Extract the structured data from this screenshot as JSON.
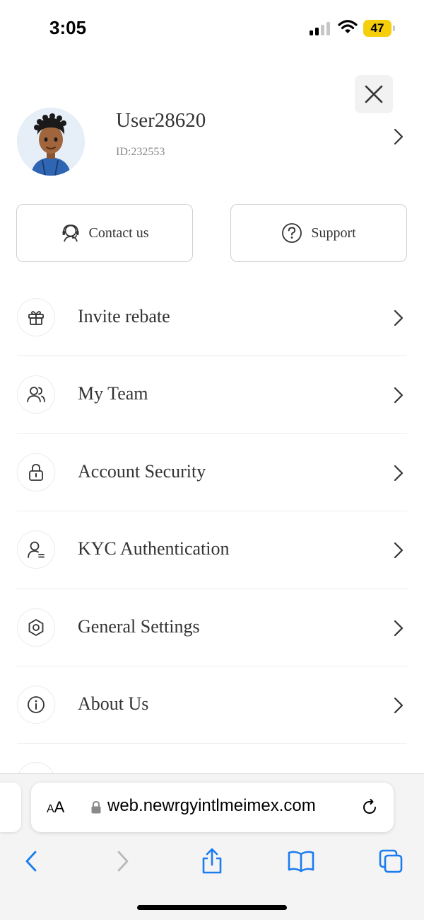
{
  "status_bar": {
    "time": "3:05",
    "battery": "47",
    "colors": {
      "battery_fill": "#f5cf0b"
    }
  },
  "profile": {
    "username": "User28620",
    "user_id": "ID:232553"
  },
  "actions": {
    "contact_label": "Contact us",
    "support_label": "Support"
  },
  "menu": {
    "items": [
      {
        "label": "Invite rebate",
        "icon": "gift-icon"
      },
      {
        "label": "My Team",
        "icon": "team-icon"
      },
      {
        "label": "Account Security",
        "icon": "lock-icon"
      },
      {
        "label": "KYC Authentication",
        "icon": "user-id-icon"
      },
      {
        "label": "General Settings",
        "icon": "settings-icon"
      },
      {
        "label": "About Us",
        "icon": "info-icon"
      }
    ]
  },
  "browser": {
    "aa_label_big": "A",
    "aa_label_small": "A",
    "url": "web.newrgyintlmeimex.com",
    "accent_color": "#1a7cf0"
  }
}
